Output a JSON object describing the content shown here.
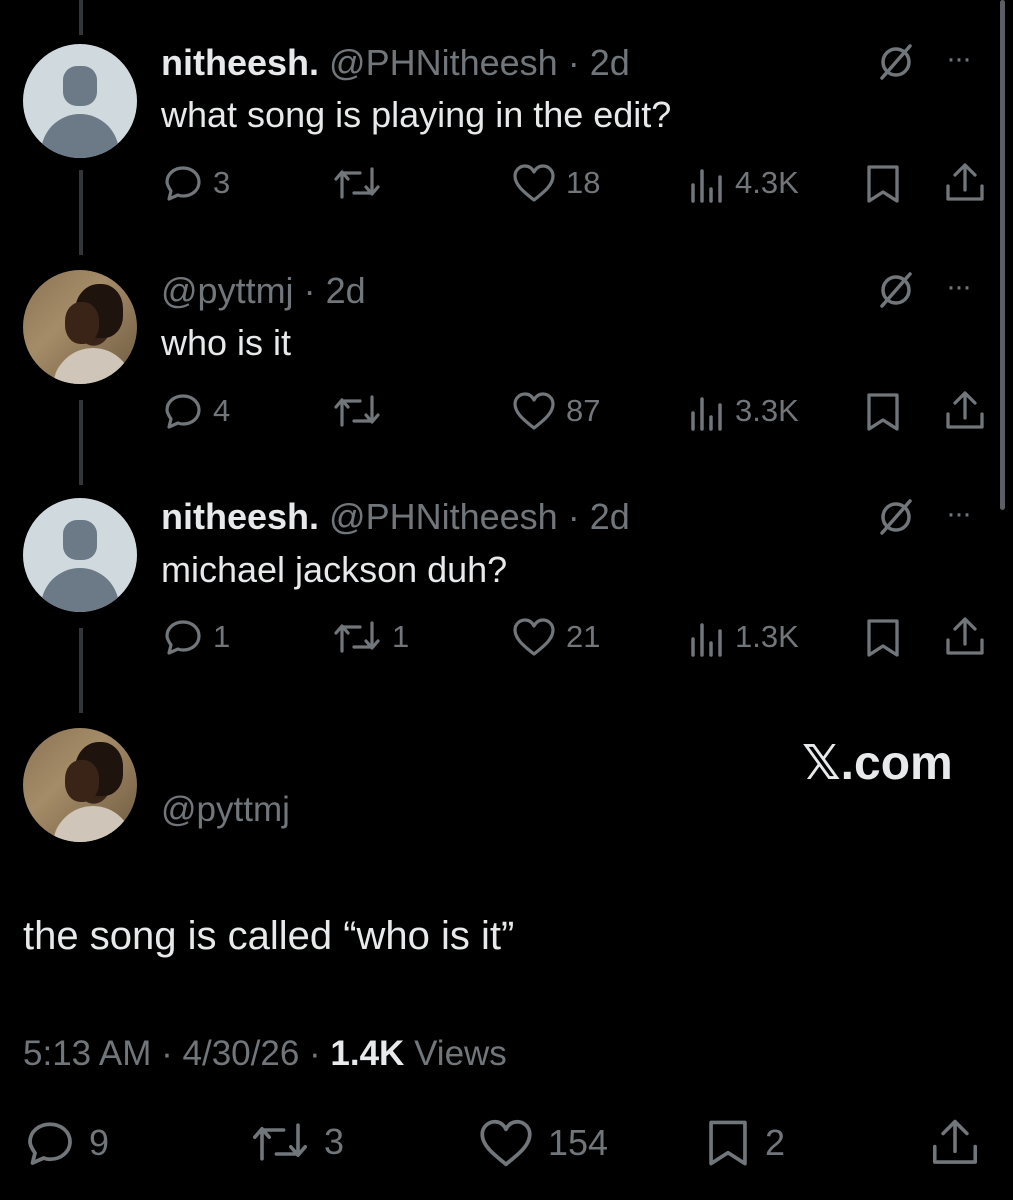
{
  "replies": [
    {
      "name": "nitheesh.",
      "handle": "@PHNitheesh",
      "time": "· 2d",
      "text": "what song is playing in the edit?",
      "replies": "3",
      "reposts": "",
      "likes": "18",
      "views": "4.3K"
    },
    {
      "name": "",
      "handle": "@pyttmj",
      "time": "· 2d",
      "text": "who is it",
      "replies": "4",
      "reposts": "",
      "likes": "87",
      "views": "3.3K"
    },
    {
      "name": "nitheesh.",
      "handle": "@PHNitheesh",
      "time": "· 2d",
      "text": "michael jackson duh?",
      "replies": "1",
      "reposts": "1",
      "likes": "21",
      "views": "1.3K"
    }
  ],
  "main_post": {
    "handle": "@pyttmj",
    "text": "the song is called “who is it”",
    "time": "5:13 AM · 4/30/26 · ",
    "views_count": "1.4K",
    "views_label": "Views",
    "replies": "9",
    "reposts": "3",
    "likes": "154",
    "bookmarks": "2"
  },
  "brand": "𝕏.com",
  "more_label": "···",
  "icons": {
    "reply": "reply-icon",
    "repost": "repost-icon",
    "like": "heart-icon",
    "views": "views-icon",
    "bookmark": "bookmark-icon",
    "share": "share-icon",
    "grok": "grok-icon"
  }
}
